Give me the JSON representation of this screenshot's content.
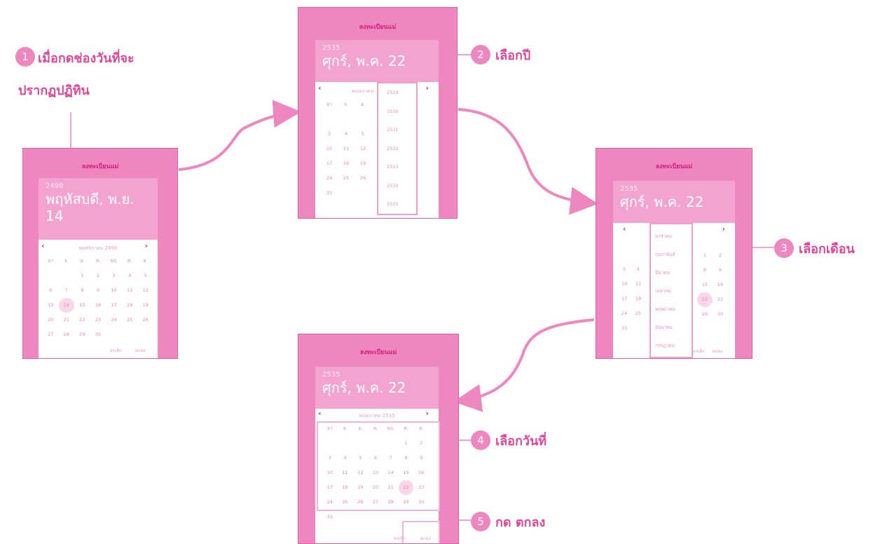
{
  "colors": {
    "primary": "#ee86bf",
    "accent": "#e0479b",
    "header": "#f2a3cf"
  },
  "steps": [
    {
      "number": "1",
      "label_line1": "เมื่อกดช่องวันที่จะ",
      "label_line2": "ปรากฏปฏิทิน"
    },
    {
      "number": "2",
      "label": "เลือกปี"
    },
    {
      "number": "3",
      "label": "เลือกเดือน"
    },
    {
      "number": "4",
      "label": "เลือกวันที่"
    },
    {
      "number": "5",
      "label": "กด ตกลง"
    }
  ],
  "panel_title": "ลงทะเบียนแม่",
  "screen1": {
    "year": "2498",
    "date_line1": "พฤหัสบดี, พ.ย.",
    "date_line2": "14",
    "month_label": "พฤศจิกายน 2498",
    "weekdays": [
      "อา",
      "จ.",
      "อ.",
      "พ.",
      "พฤ.",
      "ศ.",
      "ส."
    ],
    "days": [
      "",
      "",
      "1",
      "2",
      "3",
      "4",
      "5",
      "6",
      "7",
      "8",
      "9",
      "10",
      "11",
      "12",
      "13",
      "14",
      "15",
      "16",
      "17",
      "18",
      "19",
      "20",
      "21",
      "22",
      "23",
      "24",
      "25",
      "26",
      "27",
      "28",
      "29",
      "30",
      "",
      "",
      ""
    ],
    "cancel": "ยกเลิก",
    "ok": "ตกลง"
  },
  "screen2": {
    "year": "2535",
    "date": "ศุกร์, พ.ค. 22",
    "month_label": "พฤษภาคม",
    "years": [
      "2529",
      "2530",
      "2531",
      "2532",
      "2533",
      "2534",
      "2535"
    ],
    "weekdays": [
      "อา",
      "จ.",
      "อ."
    ],
    "days": [
      "",
      "",
      "",
      "3",
      "4",
      "5",
      "10",
      "11",
      "12",
      "17",
      "18",
      "19",
      "24",
      "25",
      "26",
      "31",
      "",
      ""
    ]
  },
  "screen3": {
    "year": "2535",
    "date": "ศุกร์, พ.ค. 22",
    "months": [
      "มกราคม",
      "กุมภาพันธ์",
      "มีนาคม",
      "เมษายน",
      "พฤษภาคม",
      "มิถุนายน",
      "กรกฎาคม"
    ],
    "left_days": [
      "3",
      "4",
      "10",
      "11",
      "17",
      "18",
      "24",
      "25",
      "31"
    ],
    "right_days": [
      "1",
      "2",
      "8",
      "9",
      "15",
      "16",
      "22",
      "23",
      "29",
      "30"
    ],
    "cancel": "ยกเลิก",
    "ok": "ตกลง"
  },
  "screen4": {
    "year": "2535",
    "date": "ศุกร์, พ.ค. 22",
    "month_label": "พฤษภาคม 2535",
    "weekdays": [
      "อา",
      "จ.",
      "อ.",
      "พ.",
      "พฤ.",
      "ศ.",
      "ส."
    ],
    "days": [
      "",
      "",
      "",
      "",
      "",
      "1",
      "2",
      "3",
      "4",
      "5",
      "6",
      "7",
      "8",
      "9",
      "10",
      "11",
      "12",
      "13",
      "14",
      "15",
      "16",
      "17",
      "18",
      "19",
      "20",
      "21",
      "22",
      "23",
      "24",
      "25",
      "26",
      "27",
      "28",
      "29",
      "30",
      "31"
    ],
    "cancel": "ยกเลิก",
    "ok": "ตกลง"
  }
}
